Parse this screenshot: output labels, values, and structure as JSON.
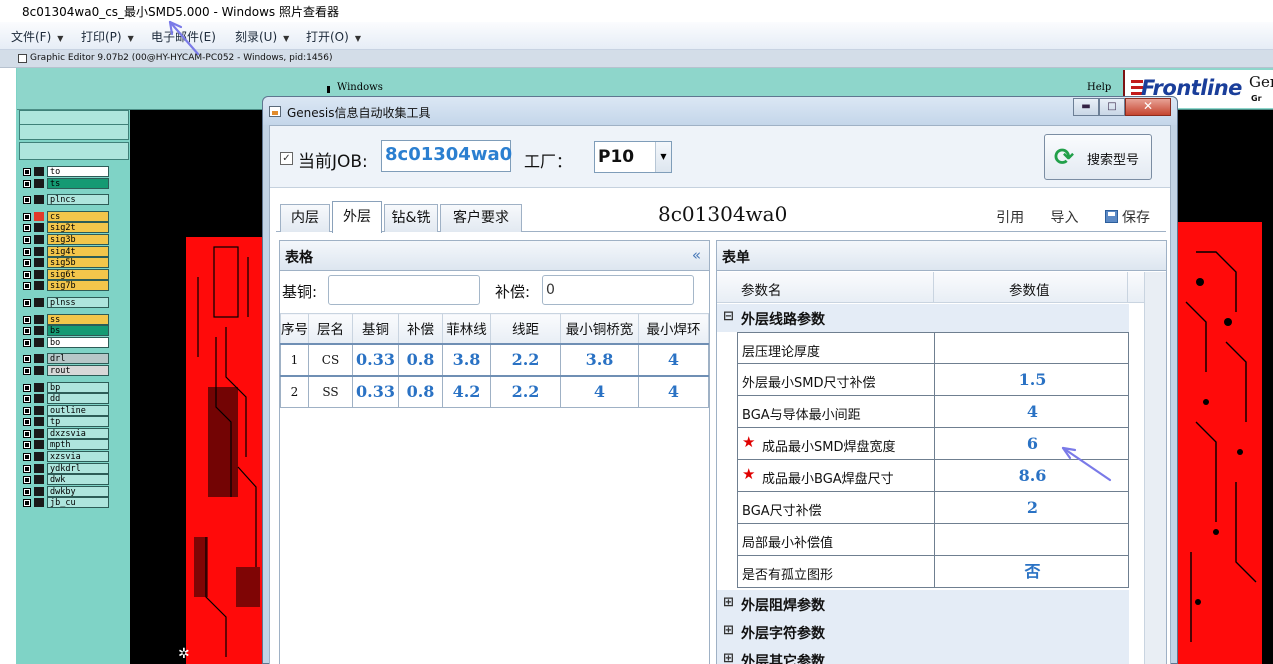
{
  "viewer": {
    "title": "8c01304wa0_cs_最小SMD5.000 - Windows 照片查看器",
    "menu": [
      "文件(F)",
      "打印(P)",
      "电子邮件(E)",
      "刻录(U)",
      "打开(O)"
    ]
  },
  "genesis": {
    "title": "Graphic Editor 9.07b2 (00@HY-HYCAM-PC052 - Windows, pid:1456)",
    "menu_windows": "Windows",
    "menu_help": "Help",
    "logo_brand": "Frontline",
    "logo_gen": "Gen",
    "logo_gen2": "Gr",
    "layers": [
      "to",
      "ts",
      "plncs",
      "cs",
      "sig2t",
      "sig3b",
      "sig4t",
      "sig5b",
      "sig6t",
      "sig7b",
      "plnss",
      "ss",
      "bs",
      "bo",
      "drl",
      "rout",
      "bp",
      "dd",
      "outline",
      "tp",
      "dxzsvia",
      "mpth",
      "xzsvia",
      "ydkdrl",
      "dwk",
      "dwkby",
      "jb_cu"
    ]
  },
  "dialog": {
    "title": "Genesis信息自动收集工具",
    "job_label": "当前JOB:",
    "job_value": "8c01304wa0",
    "factory_label": "工厂：",
    "factory_value": "P10",
    "search_button": "搜索型号",
    "tabs": [
      "内层",
      "外层",
      "钻&铣",
      "客户要求"
    ],
    "active_tab": "外层",
    "job_heading": "8c01304wa0",
    "actions": {
      "cite": "引用",
      "import": "导入",
      "save": "保存"
    },
    "left_panel": {
      "title": "表格",
      "base_copper_label": "基铜:",
      "base_copper_value": "",
      "comp_label": "补偿:",
      "comp_value": "0",
      "columns": [
        "序号",
        "层名",
        "基铜",
        "补偿",
        "菲林线",
        "线距",
        "最小铜桥宽",
        "最小焊环"
      ],
      "rows": [
        [
          "1",
          "CS",
          "0.33",
          "0.8",
          "3.8",
          "2.2",
          "3.8",
          "4"
        ],
        [
          "2",
          "SS",
          "0.33",
          "0.8",
          "4.2",
          "2.2",
          "4",
          "4"
        ]
      ]
    },
    "right_panel": {
      "title": "表单",
      "col_name": "参数名",
      "col_value": "参数值",
      "group_open": "外层线路参数",
      "params": [
        {
          "name": "层压理论厚度",
          "value": "",
          "required": false
        },
        {
          "name": "外层最小SMD尺寸补偿",
          "value": "1.5",
          "required": false
        },
        {
          "name": "BGA与导体最小间距",
          "value": "4",
          "required": false
        },
        {
          "name": "成品最小SMD焊盘宽度",
          "value": "6",
          "required": true
        },
        {
          "name": "成品最小BGA焊盘尺寸",
          "value": "8.6",
          "required": true
        },
        {
          "name": "BGA尺寸补偿",
          "value": "2",
          "required": false
        },
        {
          "name": "局部最小补偿值",
          "value": "",
          "required": false
        },
        {
          "name": "是否有孤立图形",
          "value": "否",
          "required": false
        }
      ],
      "groups_closed": [
        "外层阻焊参数",
        "外层字符参数",
        "外层其它参数"
      ]
    }
  },
  "colors": {
    "pcb_red": "#ff0a0a",
    "value_blue": "#2a72c4",
    "required_red": "#e00000",
    "annotation_arrow": "#7a7ae8"
  }
}
